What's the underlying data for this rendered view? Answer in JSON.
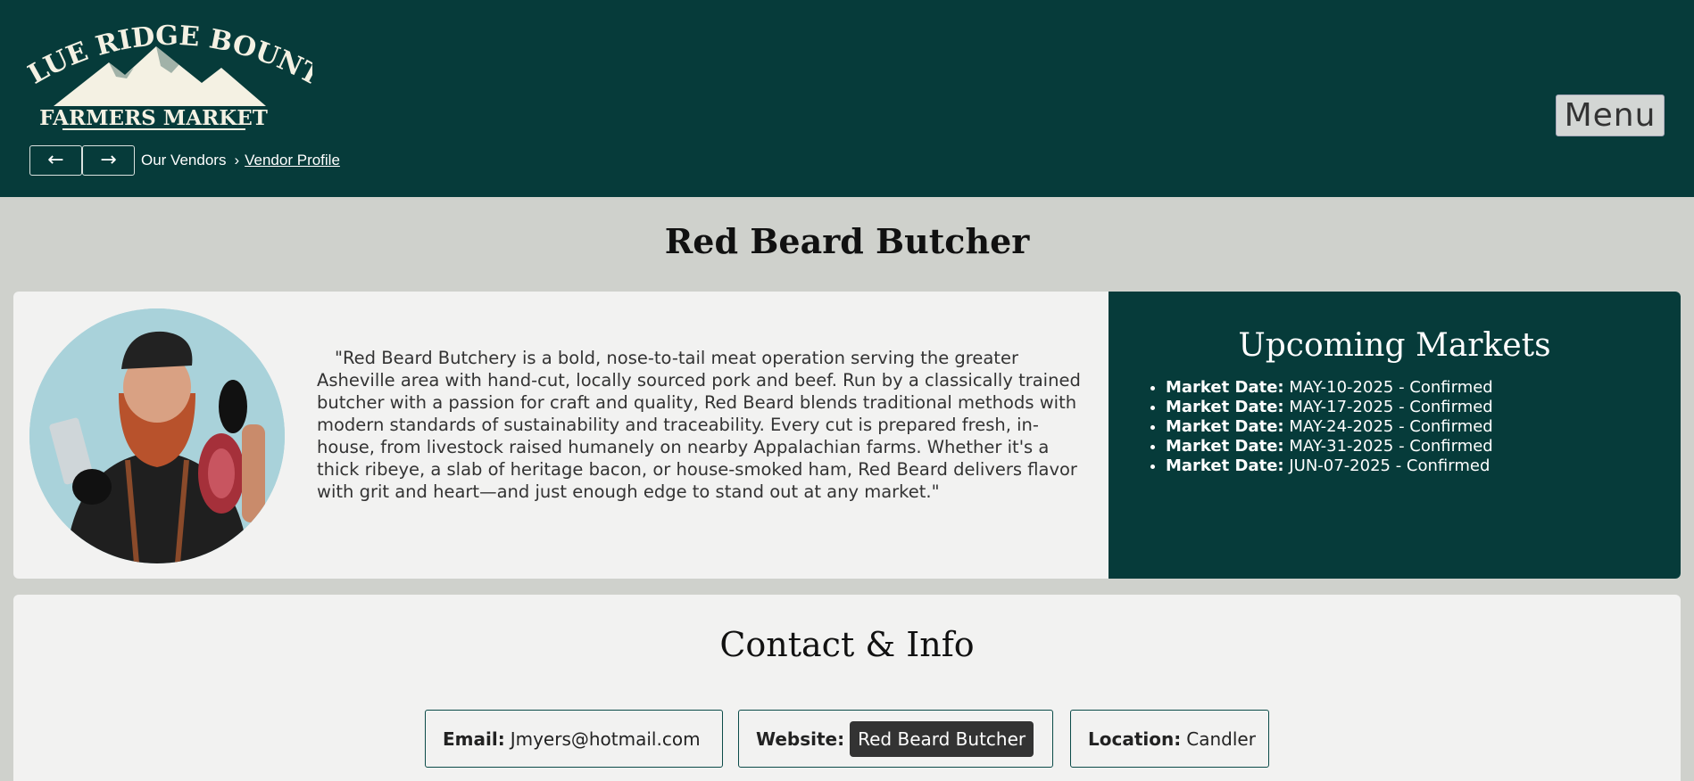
{
  "header": {
    "logo": {
      "line1": "BLUE RIDGE BOUNTY",
      "line2": "FARMERS MARKET"
    },
    "nav": {
      "back_label": "←",
      "forward_label": "→"
    },
    "breadcrumb": {
      "parent": "Our Vendors",
      "separator": "›",
      "current": "Vendor Profile"
    },
    "menu_label": "Menu"
  },
  "vendor": {
    "name": "Red Beard Butcher",
    "bio": "\"Red Beard Butchery is a bold, nose-to-tail meat operation serving the greater Asheville area with hand-cut, locally sourced pork and beef. Run by a classically trained butcher with a passion for craft and quality, Red Beard blends traditional methods with modern standards of sustainability and traceability. Every cut is prepared fresh, in-house, from livestock raised humanely on nearby Appalachian farms. Whether it's a thick ribeye, a slab of heritage bacon, or house-smoked ham, Red Beard delivers flavor with grit and heart—and just enough edge to stand out at any market.\""
  },
  "markets": {
    "title": "Upcoming Markets",
    "items": [
      {
        "label": "Market Date:",
        "value": "MAY-10-2025 - Confirmed"
      },
      {
        "label": "Market Date:",
        "value": "MAY-17-2025 - Confirmed"
      },
      {
        "label": "Market Date:",
        "value": "MAY-24-2025 - Confirmed"
      },
      {
        "label": "Market Date:",
        "value": "MAY-31-2025 - Confirmed"
      },
      {
        "label": "Market Date:",
        "value": "JUN-07-2025 - Confirmed"
      }
    ]
  },
  "contact": {
    "title": "Contact & Info",
    "email_label": "Email:",
    "email_value": "Jmyers@hotmail.com",
    "website_label": "Website:",
    "website_button": "Red Beard Butcher",
    "location_label": "Location:",
    "location_value": "Candler"
  },
  "colors": {
    "brand_dark": "#063b3a",
    "page_bg": "#cfd1cc",
    "card_bg": "#f2f2f1",
    "logo_cream": "#f4f1e3"
  }
}
